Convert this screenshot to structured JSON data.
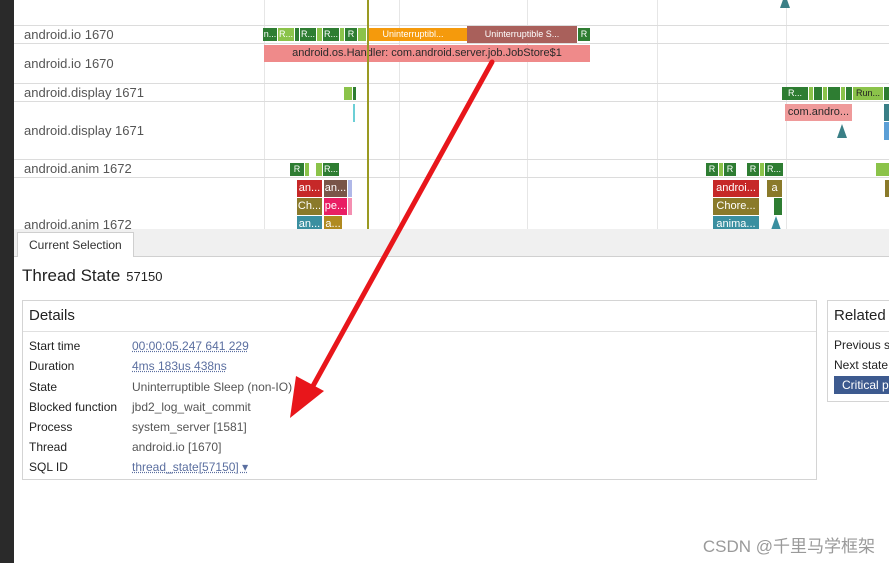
{
  "tracks": [
    {
      "name": "android.io 1670"
    },
    {
      "name": "android.io 1670"
    },
    {
      "name": "android.display 1671"
    },
    {
      "name": "android.display 1671"
    },
    {
      "name": "android.anim 1672"
    },
    {
      "name": "android.anim 1672"
    }
  ],
  "slices": {
    "uninterruptible_1": "Uninterruptibl...",
    "uninterruptible_2": "Uninterruptible S...",
    "handler": "android.os.Handler: com.android.server.job.JobStore$1",
    "r": "R",
    "r_dots": "R...",
    "n_dots": "n...",
    "run": "Run...",
    "com_andro": "com.andro...",
    "an": "an...",
    "ch": "Ch...",
    "pe": "pe...",
    "a_dots": "a...",
    "androi": "androi...",
    "chore": "Chore...",
    "anima": "anima...",
    "a": "a"
  },
  "panel": {
    "tab": "Current Selection",
    "title": "Thread State",
    "title_id": "57150",
    "details_header": "Details",
    "details": [
      {
        "key": "Start time",
        "value": "00:00:05.247 641 229",
        "link": true
      },
      {
        "key": "Duration",
        "value": "4ms 183us 438ns",
        "link": true
      },
      {
        "key": "State",
        "value": "Uninterruptible Sleep (non-IO)",
        "link": false
      },
      {
        "key": "Blocked function",
        "value": "jbd2_log_wait_commit",
        "link": false
      },
      {
        "key": "Process",
        "value": "system_server [1581]",
        "link": false
      },
      {
        "key": "Thread",
        "value": "android.io [1670]",
        "link": false
      },
      {
        "key": "SQL ID",
        "value": "thread_state[57150] ▾",
        "link": true
      }
    ],
    "related_header": "Related t",
    "related_prev": "Previous s",
    "related_next": "Next state",
    "critical_button": "Critical pa"
  },
  "watermark": "CSDN @千里马学框架",
  "colors": {
    "accent_arrow": "#e8161b",
    "running": "#2e7d32",
    "runnable": "#8bc34a",
    "uninterruptible": "#f59a0c",
    "handler": "#ef8a8a",
    "critical": "#3d5a8f"
  }
}
